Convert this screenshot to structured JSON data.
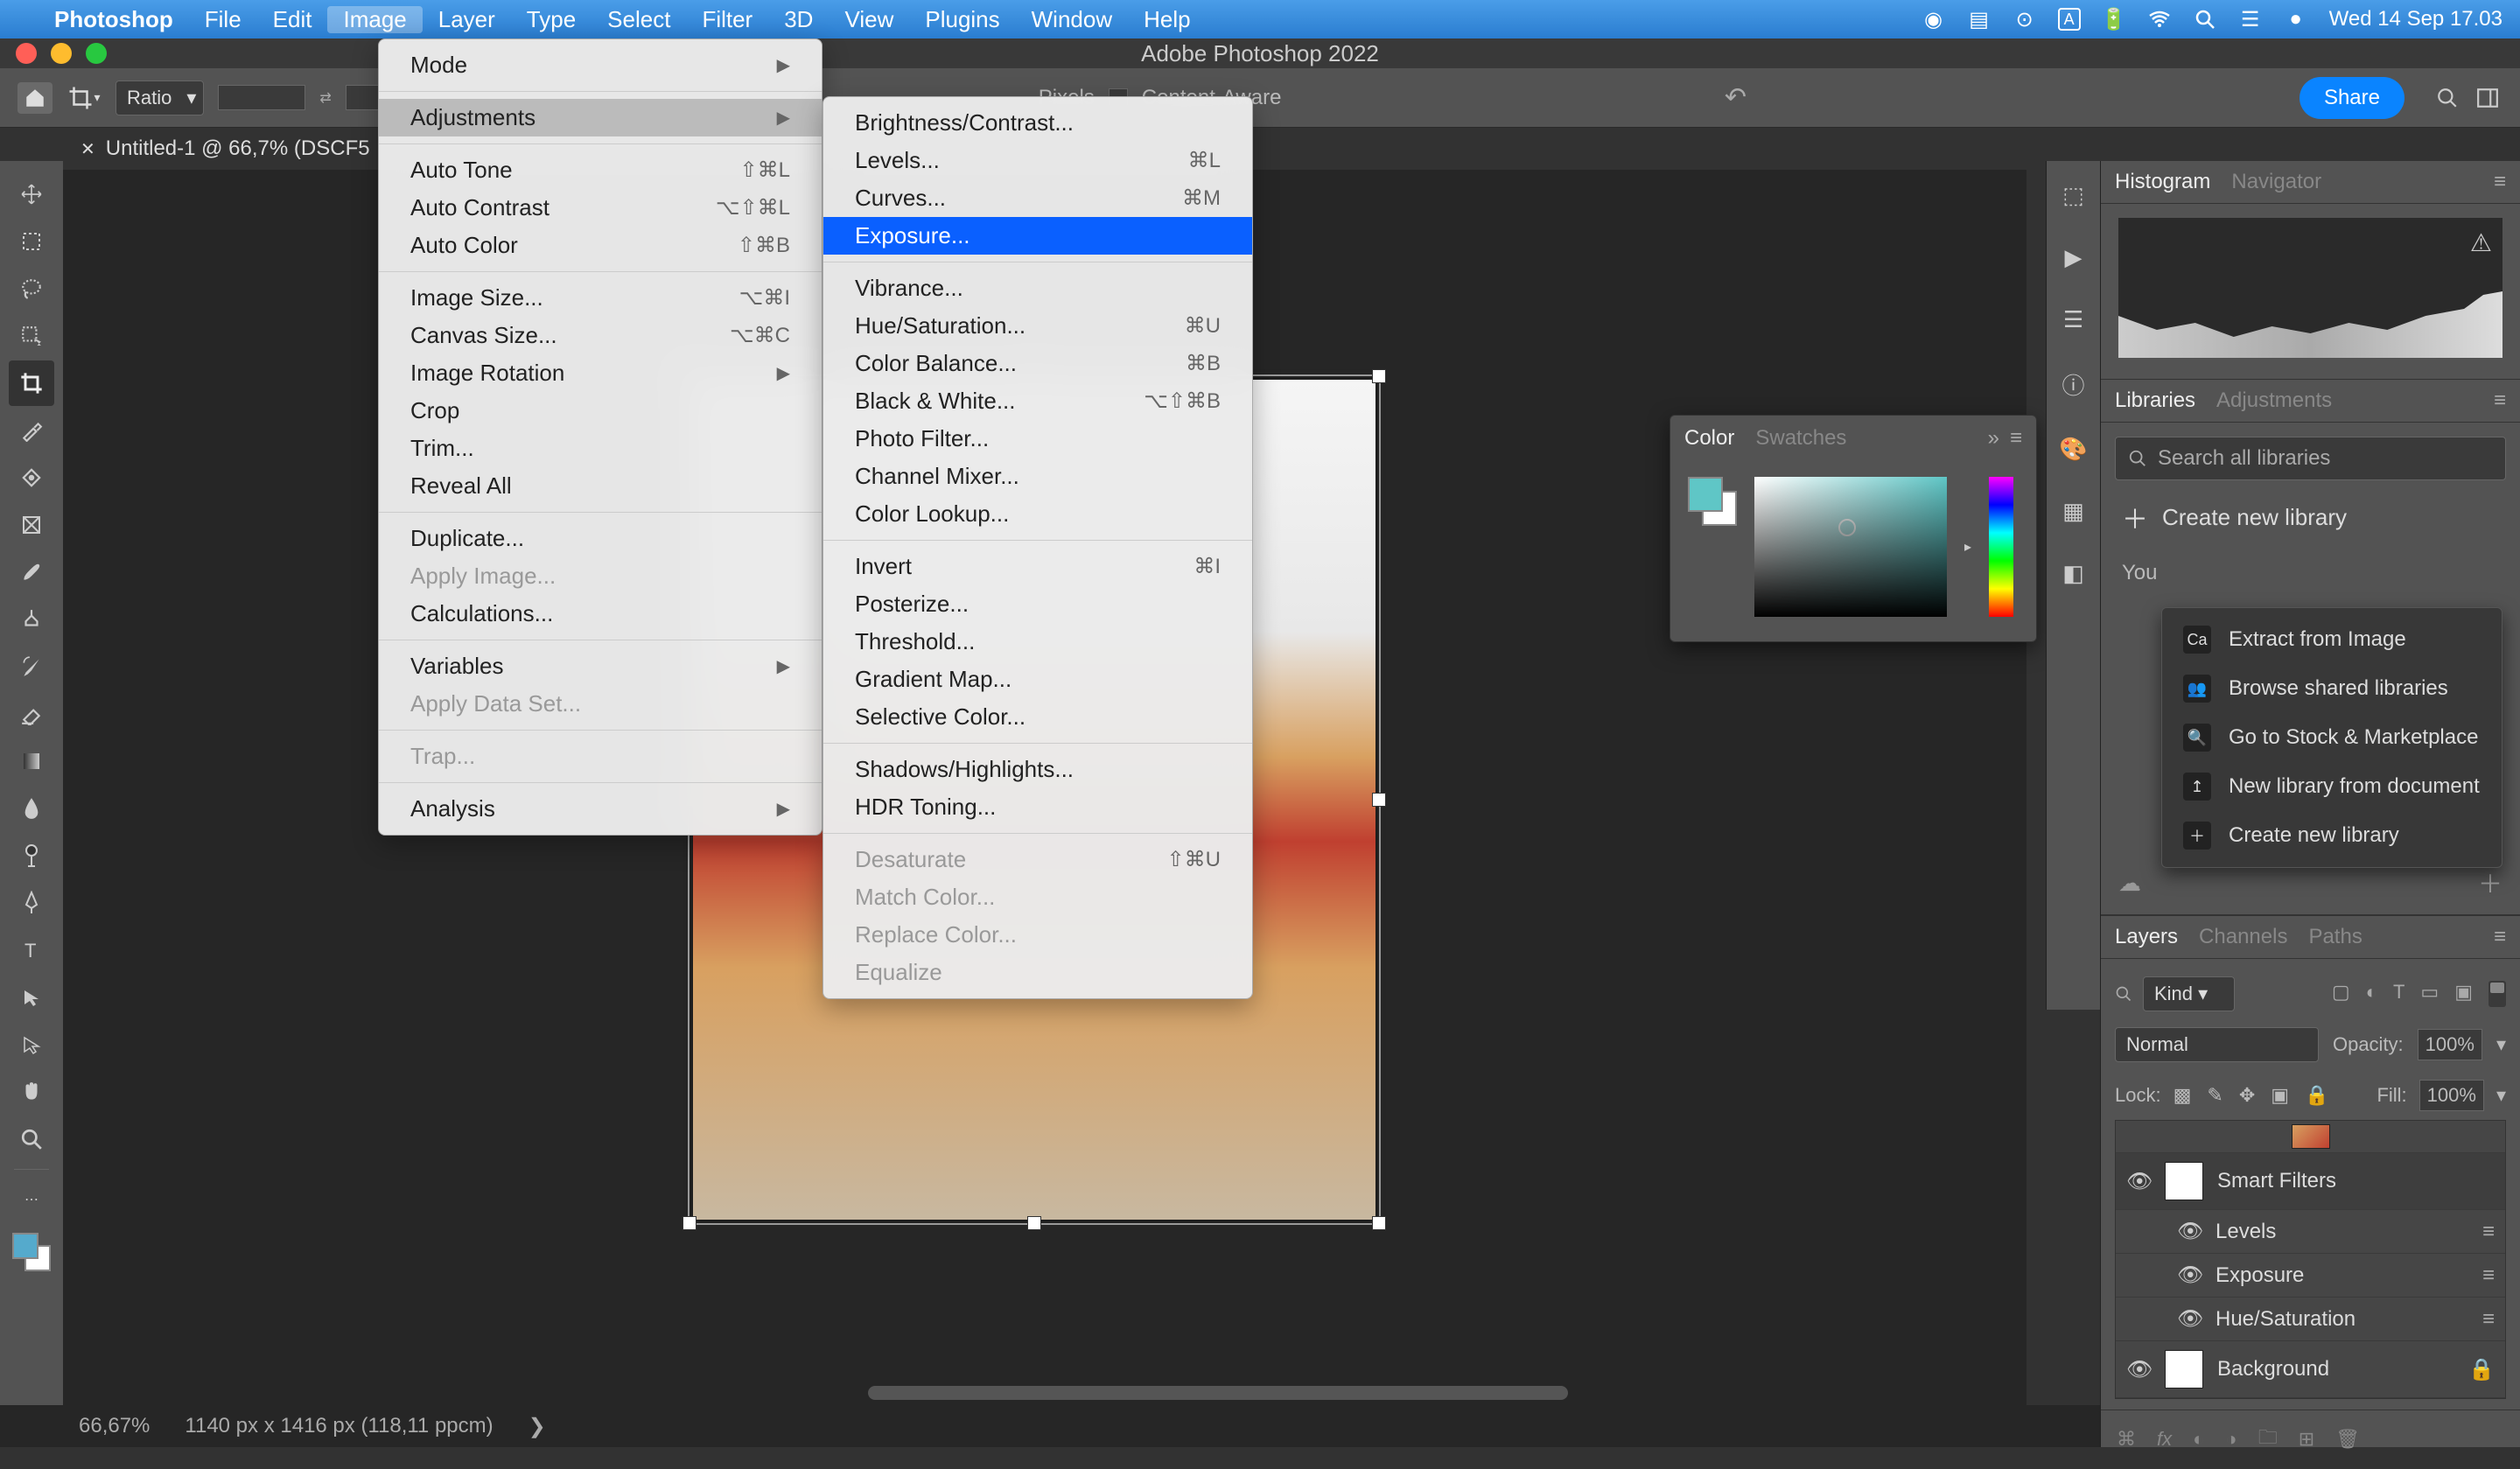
{
  "mac_menubar": {
    "app": "Photoshop",
    "items": [
      "File",
      "Edit",
      "Image",
      "Layer",
      "Type",
      "Select",
      "Filter",
      "3D",
      "View",
      "Plugins",
      "Window",
      "Help"
    ],
    "active": "Image",
    "datetime": "Wed 14 Sep  17.03"
  },
  "window": {
    "title": "Adobe Photoshop 2022"
  },
  "options_bar": {
    "ratio_label": "Ratio",
    "pixels_label": "Pixels",
    "content_aware_label": "Content-Aware",
    "share_label": "Share"
  },
  "doc_tab": {
    "title": "Untitled-1 @ 66,7% (DSCF5"
  },
  "status_bar": {
    "zoom": "66,67%",
    "dimensions": "1140 px x 1416 px (118,11 ppcm)"
  },
  "menu_image": {
    "items": [
      {
        "label": "Mode",
        "arrow": true
      },
      {
        "sep": true
      },
      {
        "label": "Adjustments",
        "arrow": true,
        "selected": true
      },
      {
        "sep": true
      },
      {
        "label": "Auto Tone",
        "shortcut": "⇧⌘L"
      },
      {
        "label": "Auto Contrast",
        "shortcut": "⌥⇧⌘L"
      },
      {
        "label": "Auto Color",
        "shortcut": "⇧⌘B"
      },
      {
        "sep": true
      },
      {
        "label": "Image Size...",
        "shortcut": "⌥⌘I"
      },
      {
        "label": "Canvas Size...",
        "shortcut": "⌥⌘C"
      },
      {
        "label": "Image Rotation",
        "arrow": true
      },
      {
        "label": "Crop"
      },
      {
        "label": "Trim..."
      },
      {
        "label": "Reveal All"
      },
      {
        "sep": true
      },
      {
        "label": "Duplicate..."
      },
      {
        "label": "Apply Image...",
        "disabled": true
      },
      {
        "label": "Calculations..."
      },
      {
        "sep": true
      },
      {
        "label": "Variables",
        "arrow": true
      },
      {
        "label": "Apply Data Set...",
        "disabled": true
      },
      {
        "sep": true
      },
      {
        "label": "Trap...",
        "disabled": true
      },
      {
        "sep": true
      },
      {
        "label": "Analysis",
        "arrow": true
      }
    ]
  },
  "menu_adjustments": {
    "items": [
      {
        "label": "Brightness/Contrast..."
      },
      {
        "label": "Levels...",
        "shortcut": "⌘L"
      },
      {
        "label": "Curves...",
        "shortcut": "⌘M"
      },
      {
        "label": "Exposure...",
        "highlighted": true
      },
      {
        "sep": true
      },
      {
        "label": "Vibrance..."
      },
      {
        "label": "Hue/Saturation...",
        "shortcut": "⌘U"
      },
      {
        "label": "Color Balance...",
        "shortcut": "⌘B"
      },
      {
        "label": "Black & White...",
        "shortcut": "⌥⇧⌘B"
      },
      {
        "label": "Photo Filter..."
      },
      {
        "label": "Channel Mixer..."
      },
      {
        "label": "Color Lookup..."
      },
      {
        "sep": true
      },
      {
        "label": "Invert",
        "shortcut": "⌘I"
      },
      {
        "label": "Posterize..."
      },
      {
        "label": "Threshold..."
      },
      {
        "label": "Gradient Map..."
      },
      {
        "label": "Selective Color..."
      },
      {
        "sep": true
      },
      {
        "label": "Shadows/Highlights..."
      },
      {
        "label": "HDR Toning..."
      },
      {
        "sep": true
      },
      {
        "label": "Desaturate",
        "shortcut": "⇧⌘U",
        "disabled": true
      },
      {
        "label": "Match Color...",
        "disabled": true
      },
      {
        "label": "Replace Color...",
        "disabled": true
      },
      {
        "label": "Equalize",
        "disabled": true
      }
    ]
  },
  "color_panel": {
    "tabs": [
      "Color",
      "Swatches"
    ],
    "active": "Color"
  },
  "panels": {
    "histogram": {
      "tabs": [
        "Histogram",
        "Navigator"
      ],
      "active": "Histogram"
    },
    "libraries": {
      "tabs": [
        "Libraries",
        "Adjustments"
      ],
      "active": "Libraries",
      "search_placeholder": "Search all libraries",
      "create_label": "Create new library",
      "you_label": "You",
      "context_items": [
        {
          "label": "Extract from Image",
          "icon": "Ca"
        },
        {
          "label": "Browse shared libraries",
          "icon": "👥"
        },
        {
          "label": "Go to Stock & Marketplace",
          "icon": "🔍"
        },
        {
          "label": "New library from document",
          "icon": "↥"
        },
        {
          "label": "Create new library",
          "icon": "＋"
        }
      ]
    },
    "layers": {
      "tabs": [
        "Layers",
        "Channels",
        "Paths"
      ],
      "active": "Layers",
      "kind_label": "Kind",
      "blend_mode": "Normal",
      "opacity_label": "Opacity:",
      "opacity_value": "100%",
      "lock_label": "Lock:",
      "fill_label": "Fill:",
      "fill_value": "100%",
      "items": [
        {
          "name": "Smart Filters",
          "type": "smart",
          "visible": true
        },
        {
          "name": "Levels",
          "type": "filter",
          "visible": true
        },
        {
          "name": "Exposure",
          "type": "filter",
          "visible": true
        },
        {
          "name": "Hue/Saturation",
          "type": "filter",
          "visible": true
        },
        {
          "name": "Background",
          "type": "bg",
          "visible": true,
          "locked": true
        }
      ]
    }
  }
}
